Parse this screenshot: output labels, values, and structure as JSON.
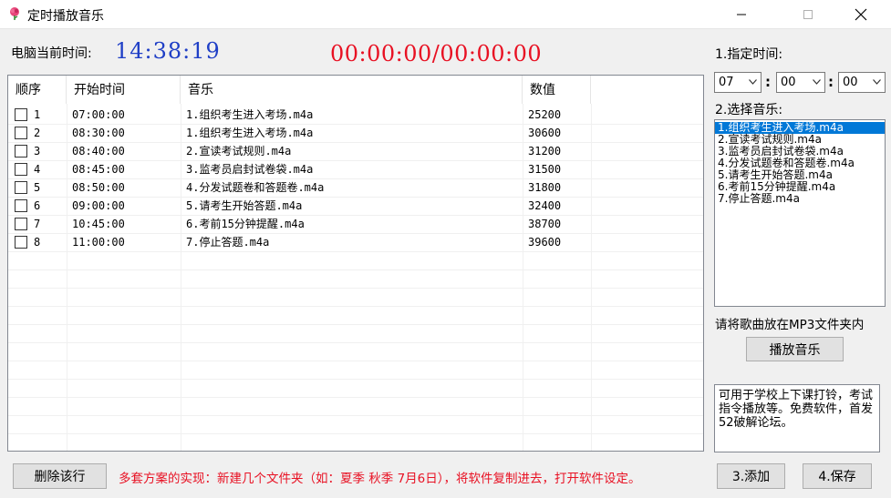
{
  "window": {
    "title": "定时播放音乐"
  },
  "clock": {
    "label": "电脑当前时间:",
    "value": "14:38:19"
  },
  "countdown": "00:00:00/00:00:00",
  "table": {
    "headers": [
      "顺序",
      "开始时间",
      "音乐",
      "数值"
    ],
    "rows": [
      {
        "order": "1",
        "time": "07:00:00",
        "music": "1.组织考生进入考场.m4a",
        "value": "25200"
      },
      {
        "order": "2",
        "time": "08:30:00",
        "music": "1.组织考生进入考场.m4a",
        "value": "30600"
      },
      {
        "order": "3",
        "time": "08:40:00",
        "music": "2.宣读考试规则.m4a",
        "value": "31200"
      },
      {
        "order": "4",
        "time": "08:45:00",
        "music": "3.监考员启封试卷袋.m4a",
        "value": "31500"
      },
      {
        "order": "5",
        "time": "08:50:00",
        "music": "4.分发试题卷和答题卷.m4a",
        "value": "31800"
      },
      {
        "order": "6",
        "time": "09:00:00",
        "music": "5.请考生开始答题.m4a",
        "value": "32400"
      },
      {
        "order": "7",
        "time": "10:45:00",
        "music": "6.考前15分钟提醒.m4a",
        "value": "38700"
      },
      {
        "order": "8",
        "time": "11:00:00",
        "music": "7.停止答题.m4a",
        "value": "39600"
      }
    ]
  },
  "schedule": {
    "time_label": "1.指定时间:",
    "hour": "07",
    "minute": "00",
    "second": "00",
    "separator": ":"
  },
  "music_select": {
    "label": "2.选择音乐:",
    "items": [
      "1.组织考生进入考场.m4a",
      "2.宣读考试规则.m4a",
      "3.监考员启封试卷袋.m4a",
      "4.分发试题卷和答题卷.m4a",
      "5.请考生开始答题.m4a",
      "6.考前15分钟提醒.m4a",
      "7.停止答题.m4a"
    ],
    "selected_index": 0
  },
  "hint_mp3": "请将歌曲放在MP3文件夹内",
  "buttons": {
    "play": "播放音乐",
    "delete_row": "删除该行",
    "add": "3.添加",
    "save": "4.保存"
  },
  "note": "可用于学校上下课打铃，考试指令播放等。免费软件，首发52破解论坛。",
  "tip": "多套方案的实现：新建几个文件夹（如：夏季 秋季 7月6日），将软件复制进去，打开软件设定。",
  "colors": {
    "clock": "#1f3fc6",
    "countdown": "#e81123",
    "selection": "#0078d7"
  }
}
